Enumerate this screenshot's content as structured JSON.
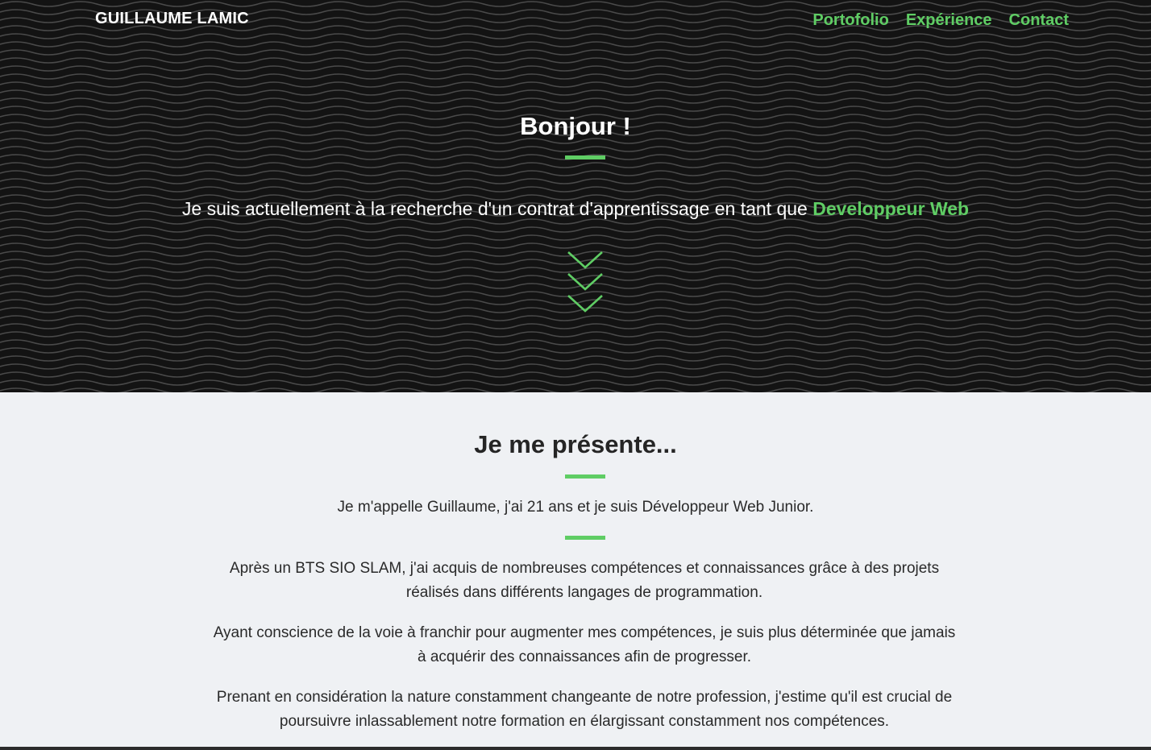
{
  "header": {
    "brand": "GUILLAUME LAMIC",
    "nav": [
      "Portofolio",
      "Expérience",
      "Contact"
    ]
  },
  "hero": {
    "title": "Bonjour !",
    "subtitle_prefix": "Je suis actuellement à la recherche d'un contrat d'apprentissage en tant que ",
    "subtitle_highlight": "Developpeur Web"
  },
  "about": {
    "title": "Je me présente...",
    "intro": "Je m'appelle Guillaume, j'ai 21 ans et je suis Développeur Web Junior.",
    "paragraphs": [
      "Après un BTS SIO SLAM, j'ai acquis de nombreuses compétences et connaissances grâce à des projets réalisés dans différents langages de programmation.",
      "Ayant conscience de la voie à franchir pour augmenter mes compétences, je suis plus déterminée que jamais à acquérir des connaissances afin de progresser.",
      "Prenant en considération la nature constamment changeante de notre profession, j'estime qu'il est crucial de poursuivre inlassablement notre formation en élargissant constamment nos compétences."
    ]
  },
  "colors": {
    "accent": "#5fcd64",
    "hero_background": "#131313",
    "page_background": "#eff1f4",
    "text_dark": "#252525"
  },
  "icons": {
    "scroll_indicator": "triple-chevron-down-icon"
  }
}
